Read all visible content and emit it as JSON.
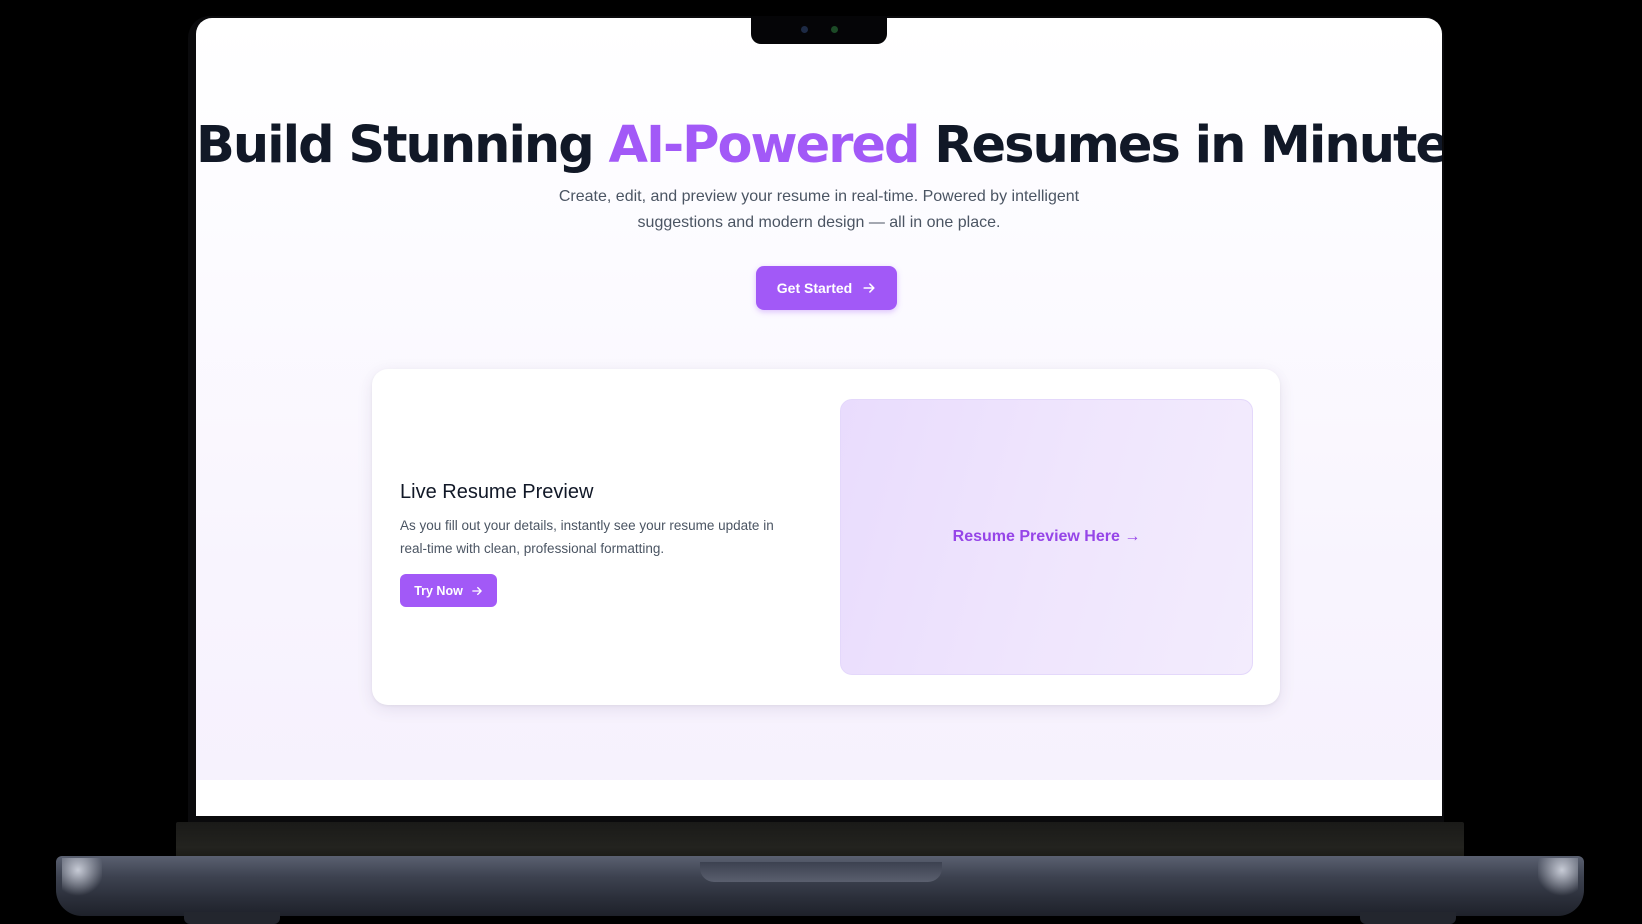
{
  "hero": {
    "title_before": "Build Stunning ",
    "title_accent": "AI-Powered",
    "title_after": " Resumes in Minutes",
    "subtitle_line1": "Create, edit, and preview your resume in real-time. Powered by intelligent",
    "subtitle_line2": "suggestions and modern design — all in one place.",
    "cta_label": "Get Started",
    "cta_icon": "arrow-right-icon"
  },
  "feature_card": {
    "title": "Live Resume Preview",
    "description_line1": "As you fill out your details, instantly see your resume update in",
    "description_line2": "real-time with clean, professional formatting.",
    "button_label": "Try Now",
    "button_icon": "arrow-right-icon",
    "preview_placeholder": "Resume Preview Here →"
  },
  "colors": {
    "accent": "#a259f7",
    "heading": "#111827",
    "body_text": "#4b5563",
    "preview_text": "#9645e8"
  }
}
